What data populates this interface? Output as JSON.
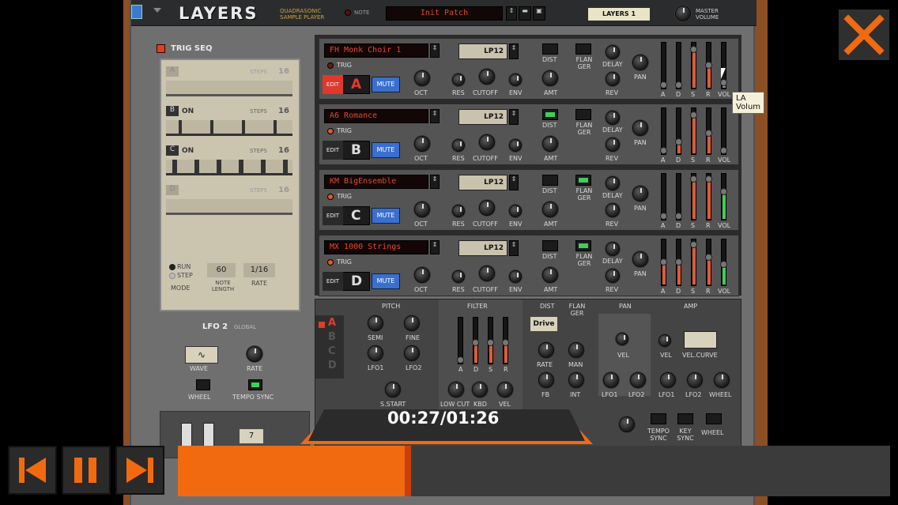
{
  "app": {
    "title": "LAYERS",
    "subtitle": "QUADRASONIC SAMPLE PLAYER",
    "note_label": "NOTE",
    "patch_name": "Init Patch",
    "instance_label": "LAYERS 1",
    "master_volume_label": "MASTER VOLUME"
  },
  "trigseq": {
    "title": "TRIG SEQ",
    "steps_label": "STEPS",
    "rows": [
      {
        "letter": "A",
        "state": "",
        "steps": "16"
      },
      {
        "letter": "B",
        "state": "ON",
        "steps": "16"
      },
      {
        "letter": "C",
        "state": "ON",
        "steps": "16"
      },
      {
        "letter": "D",
        "state": "",
        "steps": "16"
      }
    ],
    "run_label": "RUN",
    "step_label": "STEP",
    "mode_label": "MODE",
    "note_length_value": "60",
    "note_length_label": "NOTE LENGTH",
    "rate_value": "1/16",
    "rate_label": "RATE"
  },
  "lfo2": {
    "title": "LFO 2",
    "scope": "GLOBAL",
    "wave_label": "WAVE",
    "rate_label": "RATE",
    "wheel_label": "WHEEL",
    "tempo_sync_label": "TEMPO SYNC",
    "misc_value": "7"
  },
  "layers": [
    {
      "letter": "A",
      "patch": "FH Monk Choir 1",
      "edit": "EDIT",
      "mute": "MUTE",
      "trig": "TRIG",
      "filter": "LP12"
    },
    {
      "letter": "B",
      "patch": "A6 Romance",
      "edit": "EDIT",
      "mute": "MUTE",
      "trig": "TRIG",
      "filter": "LP12"
    },
    {
      "letter": "C",
      "patch": "KM BigEnsemble",
      "edit": "EDIT",
      "mute": "MUTE",
      "trig": "TRIG",
      "filter": "LP12"
    },
    {
      "letter": "D",
      "patch": "MX 1000 Strings",
      "edit": "EDIT",
      "mute": "MUTE",
      "trig": "TRIG",
      "filter": "LP12"
    }
  ],
  "layer_labels": {
    "oct": "OCT",
    "res": "RES",
    "cutoff": "CUTOFF",
    "env": "ENV",
    "dist": "DIST",
    "amt": "AMT",
    "flanger": "FLAN GER",
    "delay": "DELAY",
    "rev": "REV",
    "pan": "PAN",
    "a": "A",
    "d": "D",
    "s": "S",
    "r": "R",
    "vol": "VOL"
  },
  "tooltip": "LA Volum",
  "edit_section": {
    "pitch": "PITCH",
    "filter": "FILTER",
    "dist": "DIST",
    "flanger": "FLAN GER",
    "pan": "PAN",
    "amp": "AMP",
    "semi": "SEMI",
    "fine": "FINE",
    "lfo1": "LFO1",
    "lfo2": "LFO2",
    "s_start": "S.START",
    "low_cut": "LOW CUT",
    "kbd": "KBD",
    "vel": "VEL",
    "drive": "Drive",
    "rate": "RATE",
    "man": "MAN",
    "fb": "FB",
    "int": "INT",
    "vel_curve": "VEL.CURVE",
    "wheel": "WHEEL",
    "tempo_sync": "TEMPO SYNC",
    "key_sync": "KEY SYNC",
    "letters": [
      "A",
      "B",
      "C",
      "D"
    ]
  },
  "player": {
    "time": "00:27/01:26",
    "progress": 0.33
  }
}
